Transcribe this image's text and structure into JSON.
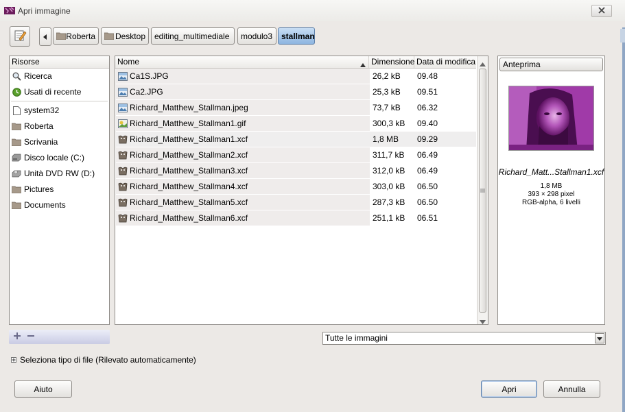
{
  "window": {
    "title": "Apri immagine",
    "title_icon": "gimp-wilber-icon",
    "close_icon": "close-icon"
  },
  "toolbar": {
    "edit_icon": "pencil-edit-icon",
    "back_icon": "chevron-left-icon"
  },
  "breadcrumbs": [
    {
      "label": "Roberta",
      "icon": "folder-icon"
    },
    {
      "label": "Desktop",
      "icon": "folder-icon"
    },
    {
      "label": "editing_multimediale"
    },
    {
      "label": "modulo3"
    },
    {
      "label": "stallman",
      "active": true
    }
  ],
  "sidebar": {
    "header": "Risorse",
    "items": [
      {
        "label": "Ricerca",
        "icon": "search-icon"
      },
      {
        "label": "Usati di recente",
        "icon": "recent-clock-icon"
      },
      {
        "label": "system32",
        "icon": "file-icon"
      },
      {
        "label": "Roberta",
        "icon": "folder-icon"
      },
      {
        "label": "Scrivania",
        "icon": "folder-icon"
      },
      {
        "label": "Disco locale (C:)",
        "icon": "harddisk-icon"
      },
      {
        "label": "Unità DVD RW (D:)",
        "icon": "dvd-drive-icon"
      },
      {
        "label": "Pictures",
        "icon": "folder-icon"
      },
      {
        "label": "Documents",
        "icon": "folder-icon"
      }
    ],
    "add_icon": "add-bookmark-icon",
    "remove_icon": "remove-bookmark-icon"
  },
  "filelist": {
    "columns": {
      "name": "Nome",
      "size": "Dimensione",
      "date": "Data di modifica"
    },
    "rows": [
      {
        "name": "Ca1S.JPG",
        "size": "26,2 kB",
        "date": "09.48",
        "icon": "image-file-icon"
      },
      {
        "name": "Ca2.JPG",
        "size": "25,3 kB",
        "date": "09.51",
        "icon": "image-file-icon"
      },
      {
        "name": "Richard_Matthew_Stallman.jpeg",
        "size": "73,7 kB",
        "date": "06.32",
        "icon": "image-file-icon"
      },
      {
        "name": "Richard_Matthew_Stallman1.gif",
        "size": "300,3 kB",
        "date": "09.40",
        "icon": "gif-file-icon"
      },
      {
        "name": "Richard_Matthew_Stallman1.xcf",
        "size": "1,8 MB",
        "date": "09.29",
        "icon": "xcf-file-icon",
        "selected": true
      },
      {
        "name": "Richard_Matthew_Stallman2.xcf",
        "size": "311,7 kB",
        "date": "06.49",
        "icon": "xcf-file-icon"
      },
      {
        "name": "Richard_Matthew_Stallman3.xcf",
        "size": "312,0 kB",
        "date": "06.49",
        "icon": "xcf-file-icon"
      },
      {
        "name": "Richard_Matthew_Stallman4.xcf",
        "size": "303,0 kB",
        "date": "06.50",
        "icon": "xcf-file-icon"
      },
      {
        "name": "Richard_Matthew_Stallman5.xcf",
        "size": "287,3 kB",
        "date": "06.50",
        "icon": "xcf-file-icon"
      },
      {
        "name": "Richard_Matthew_Stallman6.xcf",
        "size": "251,1 kB",
        "date": "06.51",
        "icon": "xcf-file-icon"
      }
    ]
  },
  "preview": {
    "header": "Anteprima",
    "filename": "Richard_Matt...Stallman1.xcf",
    "size": "1,8 MB",
    "dimensions": "393 × 298 pixel",
    "mode": "RGB-alpha, 6 livelli",
    "tint_color": "#a03aa8"
  },
  "filter": {
    "selected": "Tutte le immagini"
  },
  "filetype_expander": {
    "label": "Seleziona tipo di file (Rilevato automaticamente)"
  },
  "buttons": {
    "help": "Aiuto",
    "open": "Apri",
    "cancel": "Annulla"
  }
}
